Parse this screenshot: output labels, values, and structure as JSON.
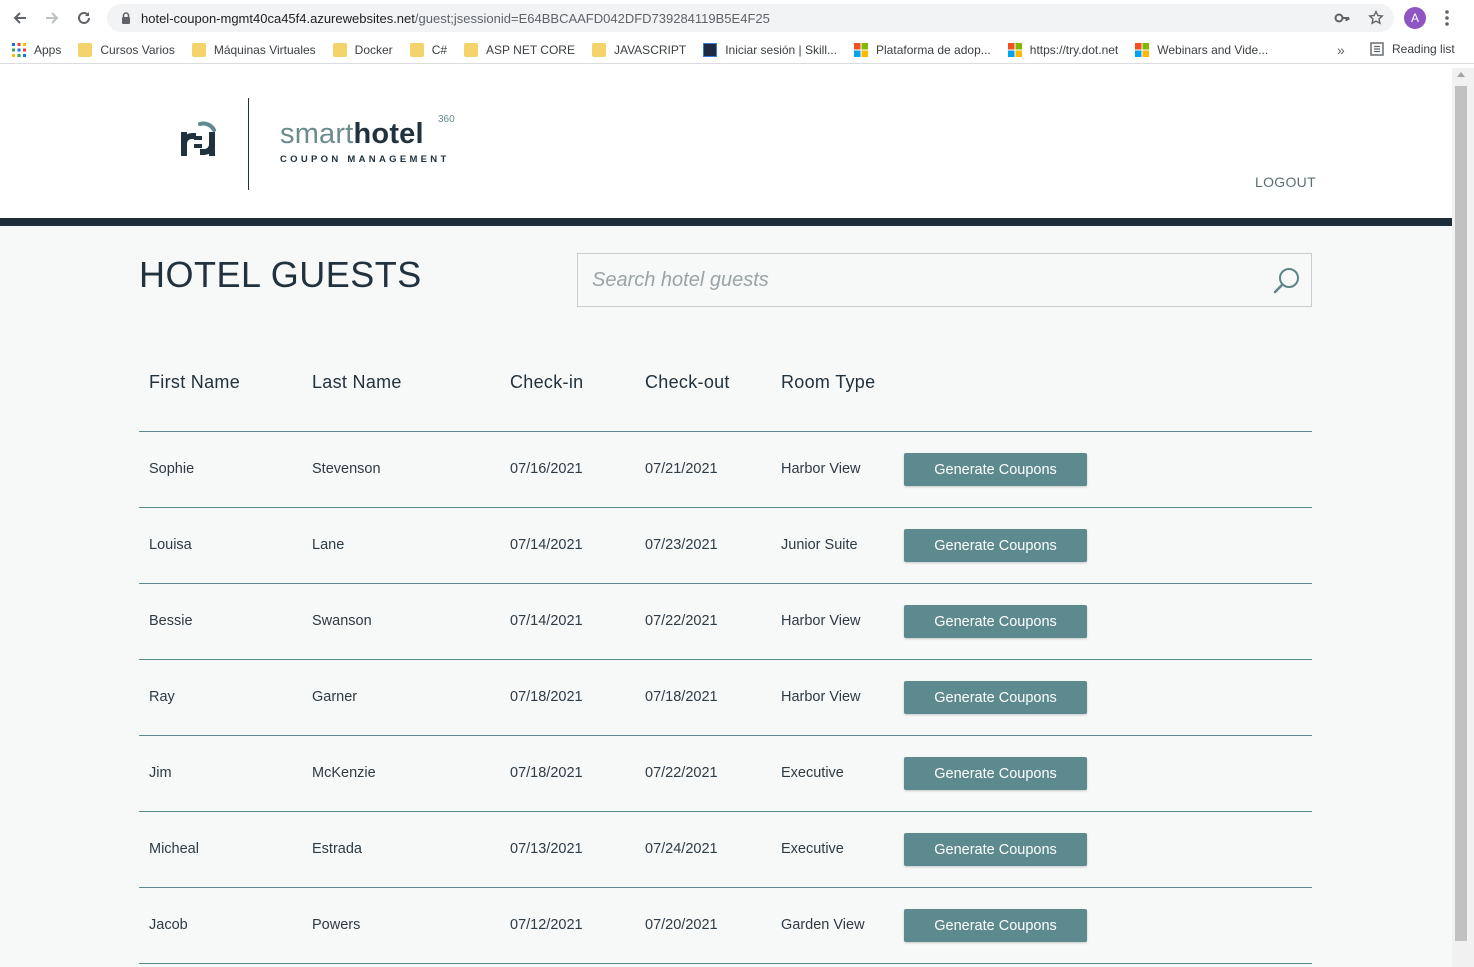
{
  "browser": {
    "url_host": "hotel-coupon-mgmt40ca45f4.azurewebsites.net",
    "url_path": "/guest;jsessionid=E64BBCAAFD042DFD739284119B5E4F25",
    "avatar_letter": "A",
    "bookmarks": [
      {
        "label": "Apps",
        "icon": "apps-grid-icon"
      },
      {
        "label": "Cursos Varios",
        "icon": "folder-icon"
      },
      {
        "label": "Máquinas Virtuales",
        "icon": "folder-icon"
      },
      {
        "label": "Docker",
        "icon": "folder-icon"
      },
      {
        "label": "C#",
        "icon": "folder-icon"
      },
      {
        "label": "ASP NET CORE",
        "icon": "folder-icon"
      },
      {
        "label": "JAVASCRIPT",
        "icon": "folder-icon"
      },
      {
        "label": "Iniciar sesión | Skill...",
        "icon": "skillsoft-icon"
      },
      {
        "label": "Plataforma de adop...",
        "icon": "microsoft-icon"
      },
      {
        "label": "https://try.dot.net",
        "icon": "microsoft-icon"
      },
      {
        "label": "Webinars and Vide...",
        "icon": "microsoft-icon"
      }
    ],
    "reading_list": "Reading list",
    "overflow": "»"
  },
  "header": {
    "brand_smart": "smart",
    "brand_hotel": "hotel",
    "brand_sup": "360",
    "brand_sub": "COUPON MANAGEMENT",
    "logout": "LOGOUT"
  },
  "main": {
    "title": "HOTEL GUESTS",
    "search_placeholder": "Search hotel guests"
  },
  "table": {
    "columns": [
      "First Name",
      "Last Name",
      "Check-in",
      "Check-out",
      "Room Type"
    ],
    "action_label": "Generate Coupons",
    "rows": [
      {
        "first": "Sophie",
        "last": "Stevenson",
        "checkin": "07/16/2021",
        "checkout": "07/21/2021",
        "room": "Harbor View"
      },
      {
        "first": "Louisa",
        "last": "Lane",
        "checkin": "07/14/2021",
        "checkout": "07/23/2021",
        "room": "Junior Suite"
      },
      {
        "first": "Bessie",
        "last": "Swanson",
        "checkin": "07/14/2021",
        "checkout": "07/22/2021",
        "room": "Harbor View"
      },
      {
        "first": "Ray",
        "last": "Garner",
        "checkin": "07/18/2021",
        "checkout": "07/18/2021",
        "room": "Harbor View"
      },
      {
        "first": "Jim",
        "last": "McKenzie",
        "checkin": "07/18/2021",
        "checkout": "07/22/2021",
        "room": "Executive"
      },
      {
        "first": "Micheal",
        "last": "Estrada",
        "checkin": "07/13/2021",
        "checkout": "07/24/2021",
        "room": "Executive"
      },
      {
        "first": "Jacob",
        "last": "Powers",
        "checkin": "07/12/2021",
        "checkout": "07/20/2021",
        "room": "Garden View"
      }
    ]
  },
  "colors": {
    "accent": "#5d8a8f",
    "dark": "#1f2d3b",
    "page_bg": "#f7f8f8"
  }
}
